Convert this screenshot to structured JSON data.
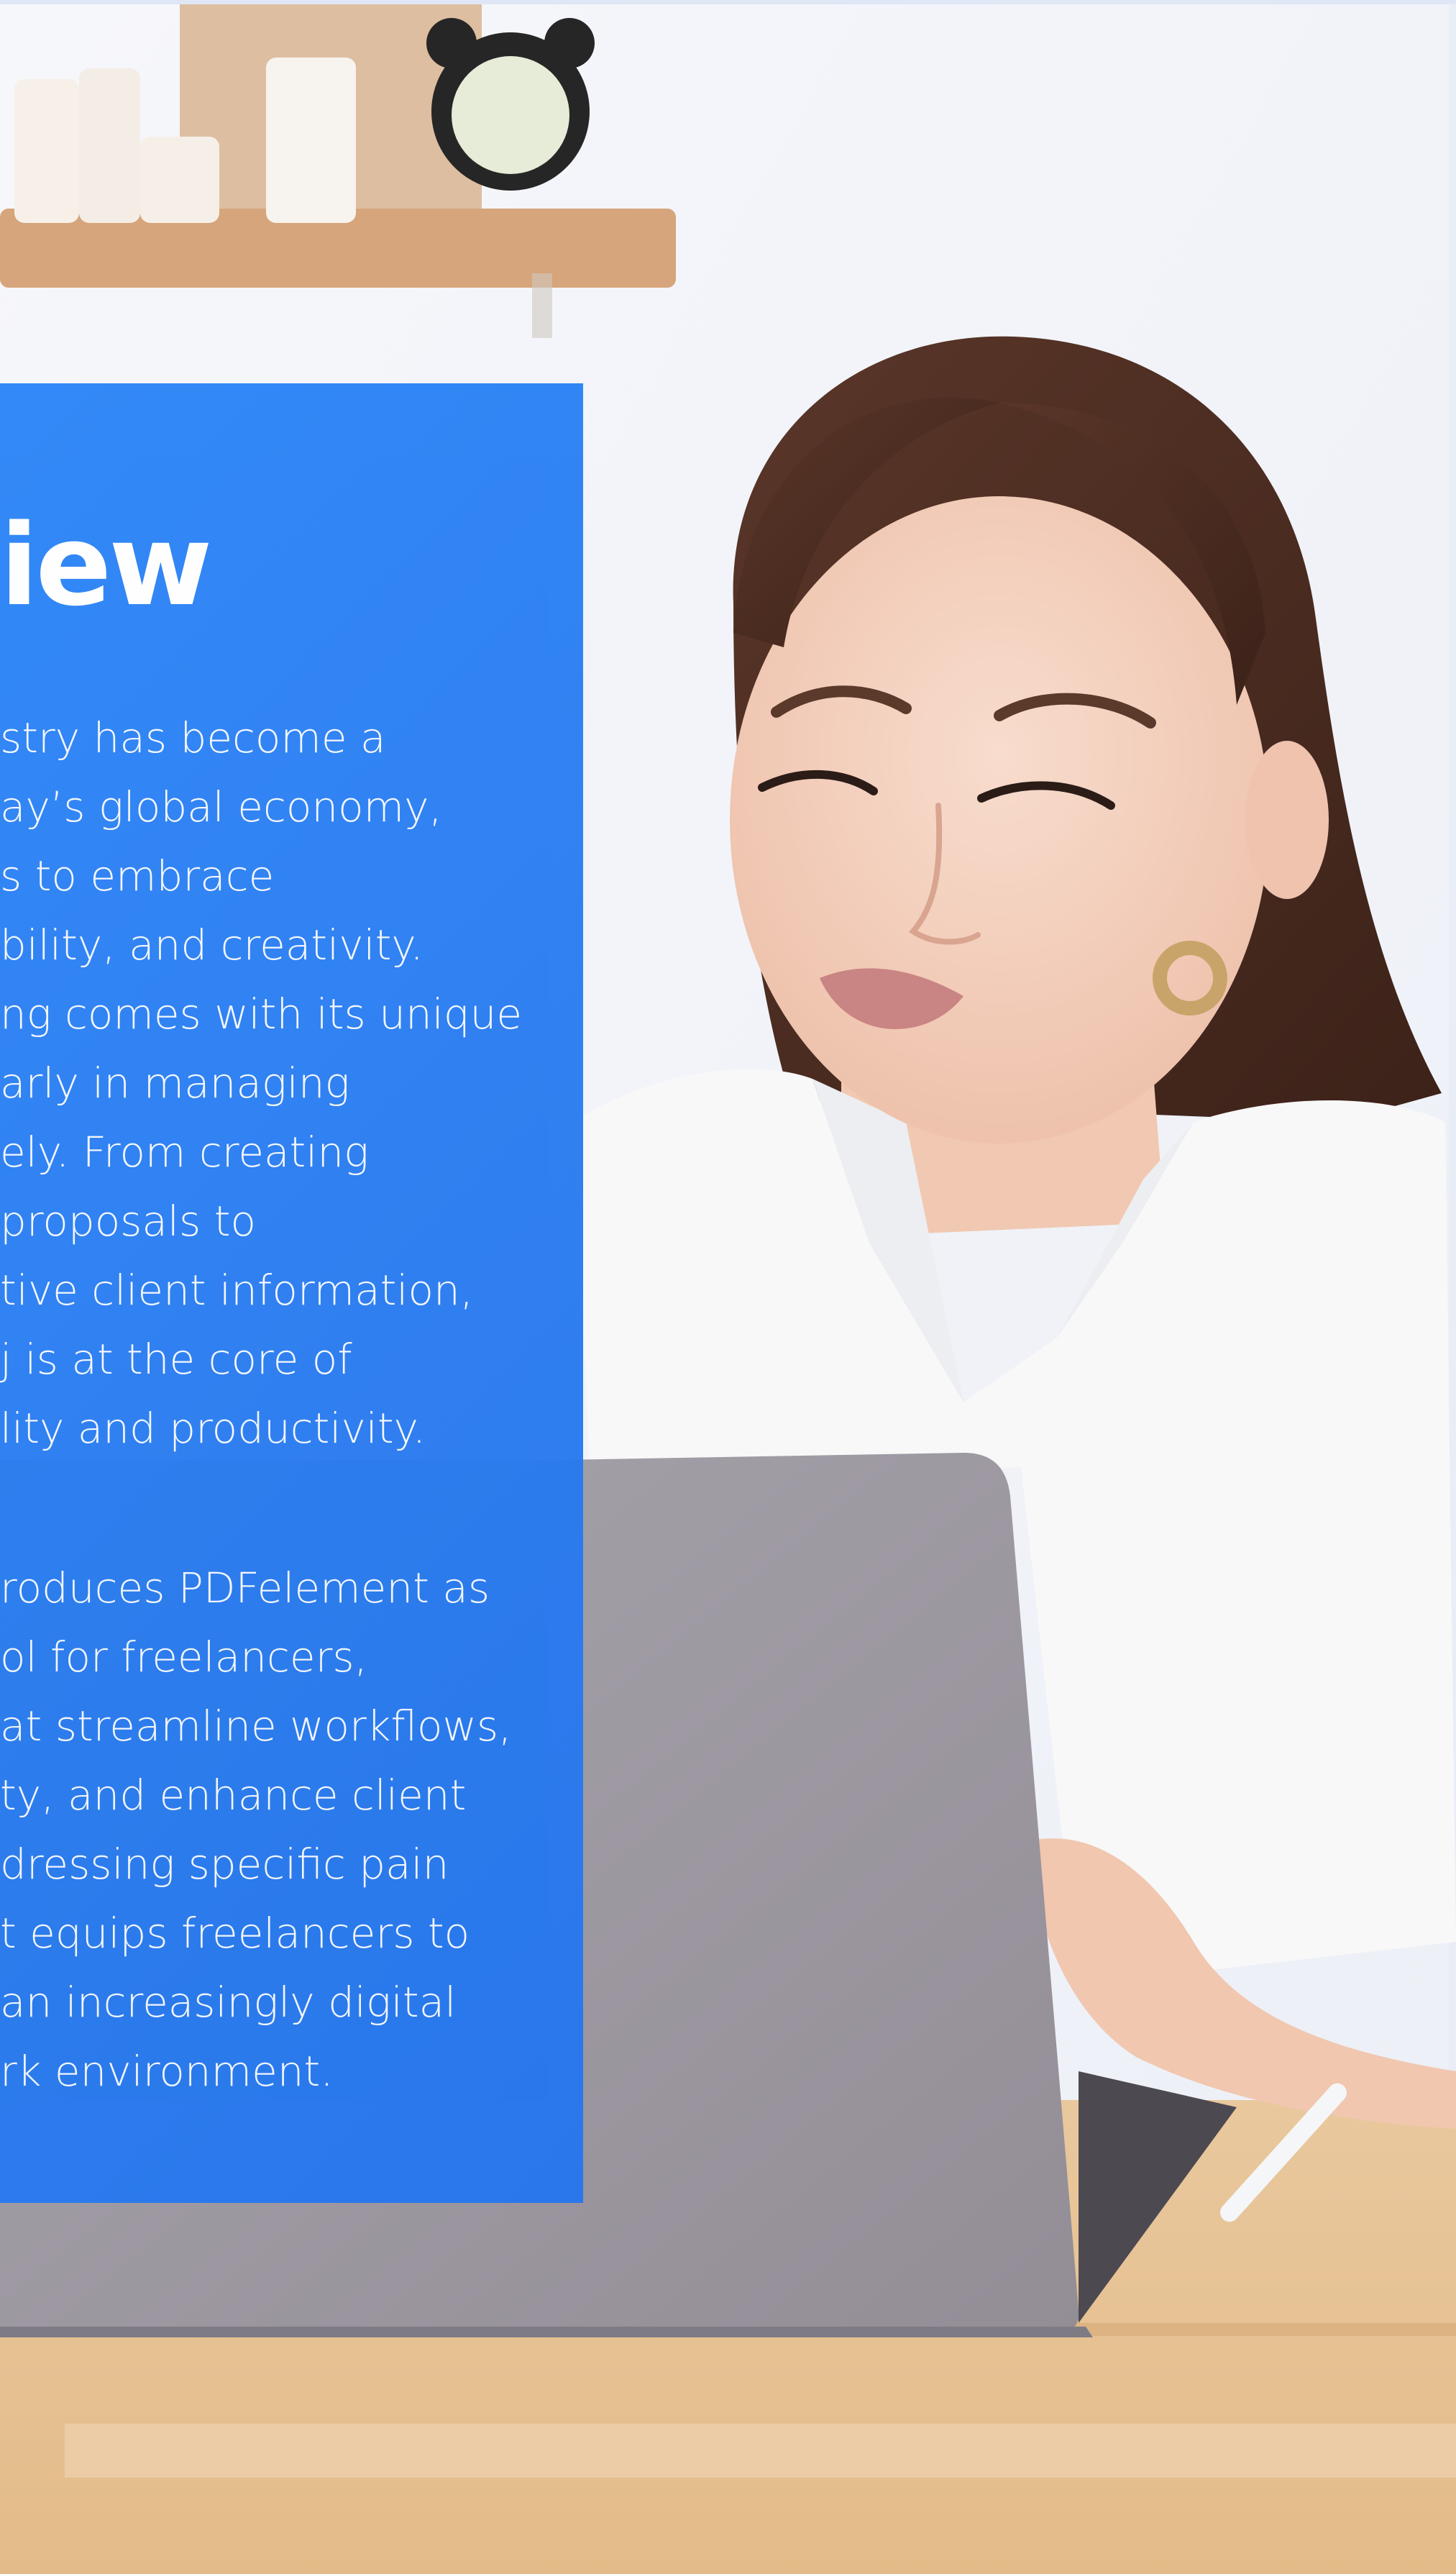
{
  "panel": {
    "title": "iew",
    "paragraph1": [
      "stry has become a",
      "ay’s global economy,",
      "s to embrace",
      "bility, and creativity.",
      "ng comes with its unique",
      "arly in managing",
      "ely. From creating",
      " proposals to",
      "tive client information,",
      "j is at the core of",
      "lity and productivity."
    ],
    "paragraph2": [
      "roduces PDFelement as",
      "ol for freelancers,",
      "at streamline workflows,",
      "ty, and enhance client",
      "dressing specific pain",
      "t equips freelancers to",
      "an increasingly digital",
      "rk environment."
    ]
  },
  "colors": {
    "panel_blue": "#2a7cf0",
    "wall": "#f3f5fb",
    "desk": "#e6c193",
    "laptop": "#9e9aa3",
    "hair": "#4a2c22",
    "shirt": "#f7f7f8"
  },
  "image": {
    "scene_icon": "woman-at-laptop-illustration"
  }
}
